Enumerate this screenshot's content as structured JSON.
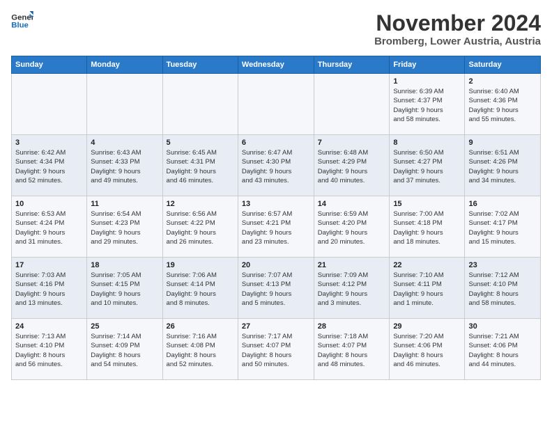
{
  "logo": {
    "line1": "General",
    "line2": "Blue"
  },
  "title": "November 2024",
  "location": "Bromberg, Lower Austria, Austria",
  "headers": [
    "Sunday",
    "Monday",
    "Tuesday",
    "Wednesday",
    "Thursday",
    "Friday",
    "Saturday"
  ],
  "weeks": [
    [
      {
        "day": "",
        "info": ""
      },
      {
        "day": "",
        "info": ""
      },
      {
        "day": "",
        "info": ""
      },
      {
        "day": "",
        "info": ""
      },
      {
        "day": "",
        "info": ""
      },
      {
        "day": "1",
        "info": "Sunrise: 6:39 AM\nSunset: 4:37 PM\nDaylight: 9 hours\nand 58 minutes."
      },
      {
        "day": "2",
        "info": "Sunrise: 6:40 AM\nSunset: 4:36 PM\nDaylight: 9 hours\nand 55 minutes."
      }
    ],
    [
      {
        "day": "3",
        "info": "Sunrise: 6:42 AM\nSunset: 4:34 PM\nDaylight: 9 hours\nand 52 minutes."
      },
      {
        "day": "4",
        "info": "Sunrise: 6:43 AM\nSunset: 4:33 PM\nDaylight: 9 hours\nand 49 minutes."
      },
      {
        "day": "5",
        "info": "Sunrise: 6:45 AM\nSunset: 4:31 PM\nDaylight: 9 hours\nand 46 minutes."
      },
      {
        "day": "6",
        "info": "Sunrise: 6:47 AM\nSunset: 4:30 PM\nDaylight: 9 hours\nand 43 minutes."
      },
      {
        "day": "7",
        "info": "Sunrise: 6:48 AM\nSunset: 4:29 PM\nDaylight: 9 hours\nand 40 minutes."
      },
      {
        "day": "8",
        "info": "Sunrise: 6:50 AM\nSunset: 4:27 PM\nDaylight: 9 hours\nand 37 minutes."
      },
      {
        "day": "9",
        "info": "Sunrise: 6:51 AM\nSunset: 4:26 PM\nDaylight: 9 hours\nand 34 minutes."
      }
    ],
    [
      {
        "day": "10",
        "info": "Sunrise: 6:53 AM\nSunset: 4:24 PM\nDaylight: 9 hours\nand 31 minutes."
      },
      {
        "day": "11",
        "info": "Sunrise: 6:54 AM\nSunset: 4:23 PM\nDaylight: 9 hours\nand 29 minutes."
      },
      {
        "day": "12",
        "info": "Sunrise: 6:56 AM\nSunset: 4:22 PM\nDaylight: 9 hours\nand 26 minutes."
      },
      {
        "day": "13",
        "info": "Sunrise: 6:57 AM\nSunset: 4:21 PM\nDaylight: 9 hours\nand 23 minutes."
      },
      {
        "day": "14",
        "info": "Sunrise: 6:59 AM\nSunset: 4:20 PM\nDaylight: 9 hours\nand 20 minutes."
      },
      {
        "day": "15",
        "info": "Sunrise: 7:00 AM\nSunset: 4:18 PM\nDaylight: 9 hours\nand 18 minutes."
      },
      {
        "day": "16",
        "info": "Sunrise: 7:02 AM\nSunset: 4:17 PM\nDaylight: 9 hours\nand 15 minutes."
      }
    ],
    [
      {
        "day": "17",
        "info": "Sunrise: 7:03 AM\nSunset: 4:16 PM\nDaylight: 9 hours\nand 13 minutes."
      },
      {
        "day": "18",
        "info": "Sunrise: 7:05 AM\nSunset: 4:15 PM\nDaylight: 9 hours\nand 10 minutes."
      },
      {
        "day": "19",
        "info": "Sunrise: 7:06 AM\nSunset: 4:14 PM\nDaylight: 9 hours\nand 8 minutes."
      },
      {
        "day": "20",
        "info": "Sunrise: 7:07 AM\nSunset: 4:13 PM\nDaylight: 9 hours\nand 5 minutes."
      },
      {
        "day": "21",
        "info": "Sunrise: 7:09 AM\nSunset: 4:12 PM\nDaylight: 9 hours\nand 3 minutes."
      },
      {
        "day": "22",
        "info": "Sunrise: 7:10 AM\nSunset: 4:11 PM\nDaylight: 9 hours\nand 1 minute."
      },
      {
        "day": "23",
        "info": "Sunrise: 7:12 AM\nSunset: 4:10 PM\nDaylight: 8 hours\nand 58 minutes."
      }
    ],
    [
      {
        "day": "24",
        "info": "Sunrise: 7:13 AM\nSunset: 4:10 PM\nDaylight: 8 hours\nand 56 minutes."
      },
      {
        "day": "25",
        "info": "Sunrise: 7:14 AM\nSunset: 4:09 PM\nDaylight: 8 hours\nand 54 minutes."
      },
      {
        "day": "26",
        "info": "Sunrise: 7:16 AM\nSunset: 4:08 PM\nDaylight: 8 hours\nand 52 minutes."
      },
      {
        "day": "27",
        "info": "Sunrise: 7:17 AM\nSunset: 4:07 PM\nDaylight: 8 hours\nand 50 minutes."
      },
      {
        "day": "28",
        "info": "Sunrise: 7:18 AM\nSunset: 4:07 PM\nDaylight: 8 hours\nand 48 minutes."
      },
      {
        "day": "29",
        "info": "Sunrise: 7:20 AM\nSunset: 4:06 PM\nDaylight: 8 hours\nand 46 minutes."
      },
      {
        "day": "30",
        "info": "Sunrise: 7:21 AM\nSunset: 4:06 PM\nDaylight: 8 hours\nand 44 minutes."
      }
    ]
  ]
}
